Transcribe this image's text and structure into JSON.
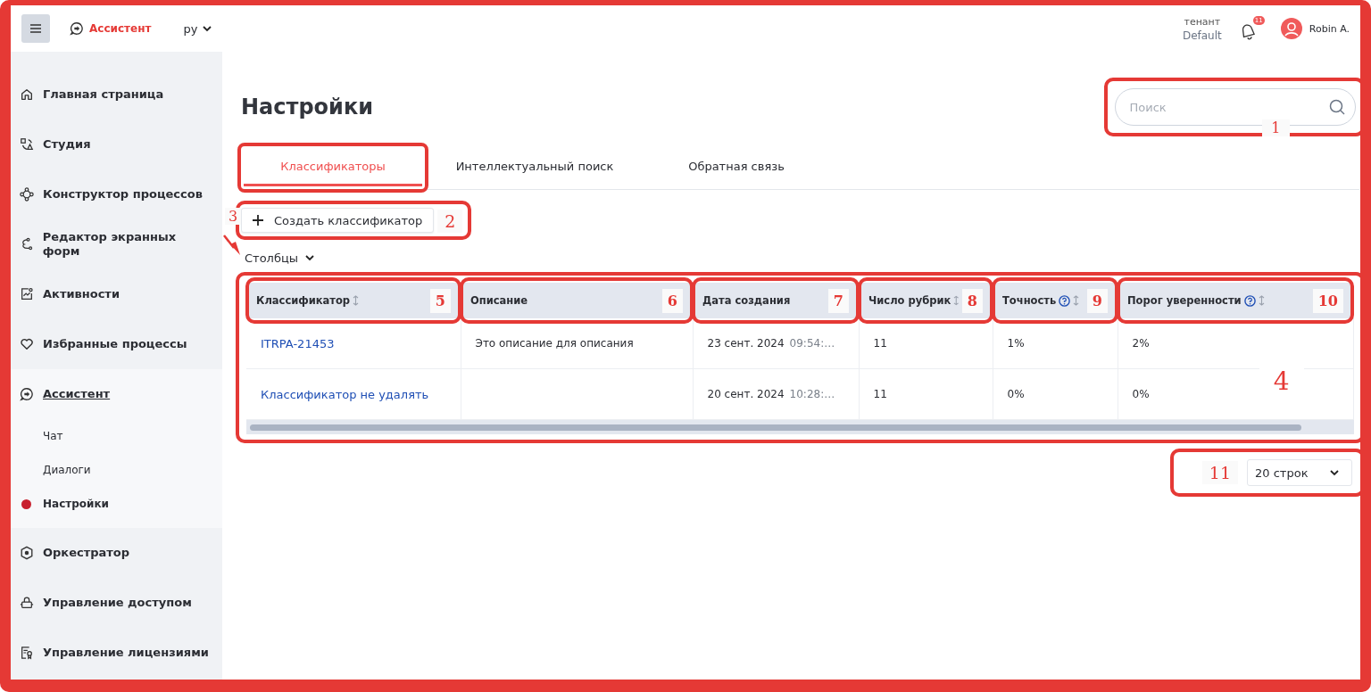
{
  "header": {
    "brand": "Ассистент",
    "language": "ру",
    "tenant_label": "тенант",
    "tenant": "Default",
    "notifications": "11",
    "user": "Robin A."
  },
  "sidebar": {
    "items": [
      {
        "label": "Главная страница",
        "selected": false
      },
      {
        "label": "Студия",
        "selected": false
      },
      {
        "label": "Конструктор процессов",
        "selected": false
      },
      {
        "label": "Редактор экранных форм",
        "selected": false
      },
      {
        "label": "Активности",
        "selected": false
      },
      {
        "label": "Избранные процессы",
        "selected": false
      },
      {
        "label": "Ассистент",
        "selected": true,
        "children": [
          {
            "label": "Чат",
            "selected": false
          },
          {
            "label": "Диалоги",
            "selected": false
          },
          {
            "label": "Настройки",
            "selected": true
          }
        ]
      },
      {
        "label": "Оркестратор",
        "selected": false
      },
      {
        "label": "Управление доступом",
        "selected": false
      },
      {
        "label": "Управление лицензиями",
        "selected": false
      }
    ]
  },
  "page": {
    "title": "Настройки"
  },
  "search": {
    "placeholder": "Поиск",
    "annotation": "1"
  },
  "tabs": [
    {
      "label": "Классификаторы",
      "selected": true,
      "outlined": true
    },
    {
      "label": "Интеллектуальный поиск",
      "selected": false,
      "outlined": false
    },
    {
      "label": "Обратная связь",
      "selected": false,
      "outlined": false
    }
  ],
  "create_button": {
    "label": "Создать классификатор",
    "annotation": "2"
  },
  "columns_control": {
    "label": "Столбцы",
    "annotation": "3"
  },
  "table": {
    "annotation": "4",
    "columns": [
      {
        "label": "Классификатор",
        "sortable": true,
        "help": false,
        "annotation": "5"
      },
      {
        "label": "Описание",
        "sortable": false,
        "help": false,
        "annotation": "6"
      },
      {
        "label": "Дата создания",
        "sortable": false,
        "help": false,
        "annotation": "7"
      },
      {
        "label": "Число рубрик",
        "sortable": true,
        "help": false,
        "annotation": "8"
      },
      {
        "label": "Точность",
        "sortable": true,
        "help": true,
        "annotation": "9"
      },
      {
        "label": "Порог уверенности",
        "sortable": true,
        "help": true,
        "annotation": "10"
      }
    ],
    "rows": [
      {
        "name": "ITRPA-21453",
        "description": "Это описание для описания",
        "date": "23 сент. 2024",
        "time": "09:54:…",
        "categories": "11",
        "accuracy": "1%",
        "threshold": "2%"
      },
      {
        "name": "Классификатор не удалять",
        "date": "20 сент. 2024",
        "time": "10:28:…",
        "categories": "11",
        "accuracy": "0%",
        "threshold": "0%"
      }
    ]
  },
  "page_size": {
    "value": "20 строк",
    "annotation": "11"
  }
}
